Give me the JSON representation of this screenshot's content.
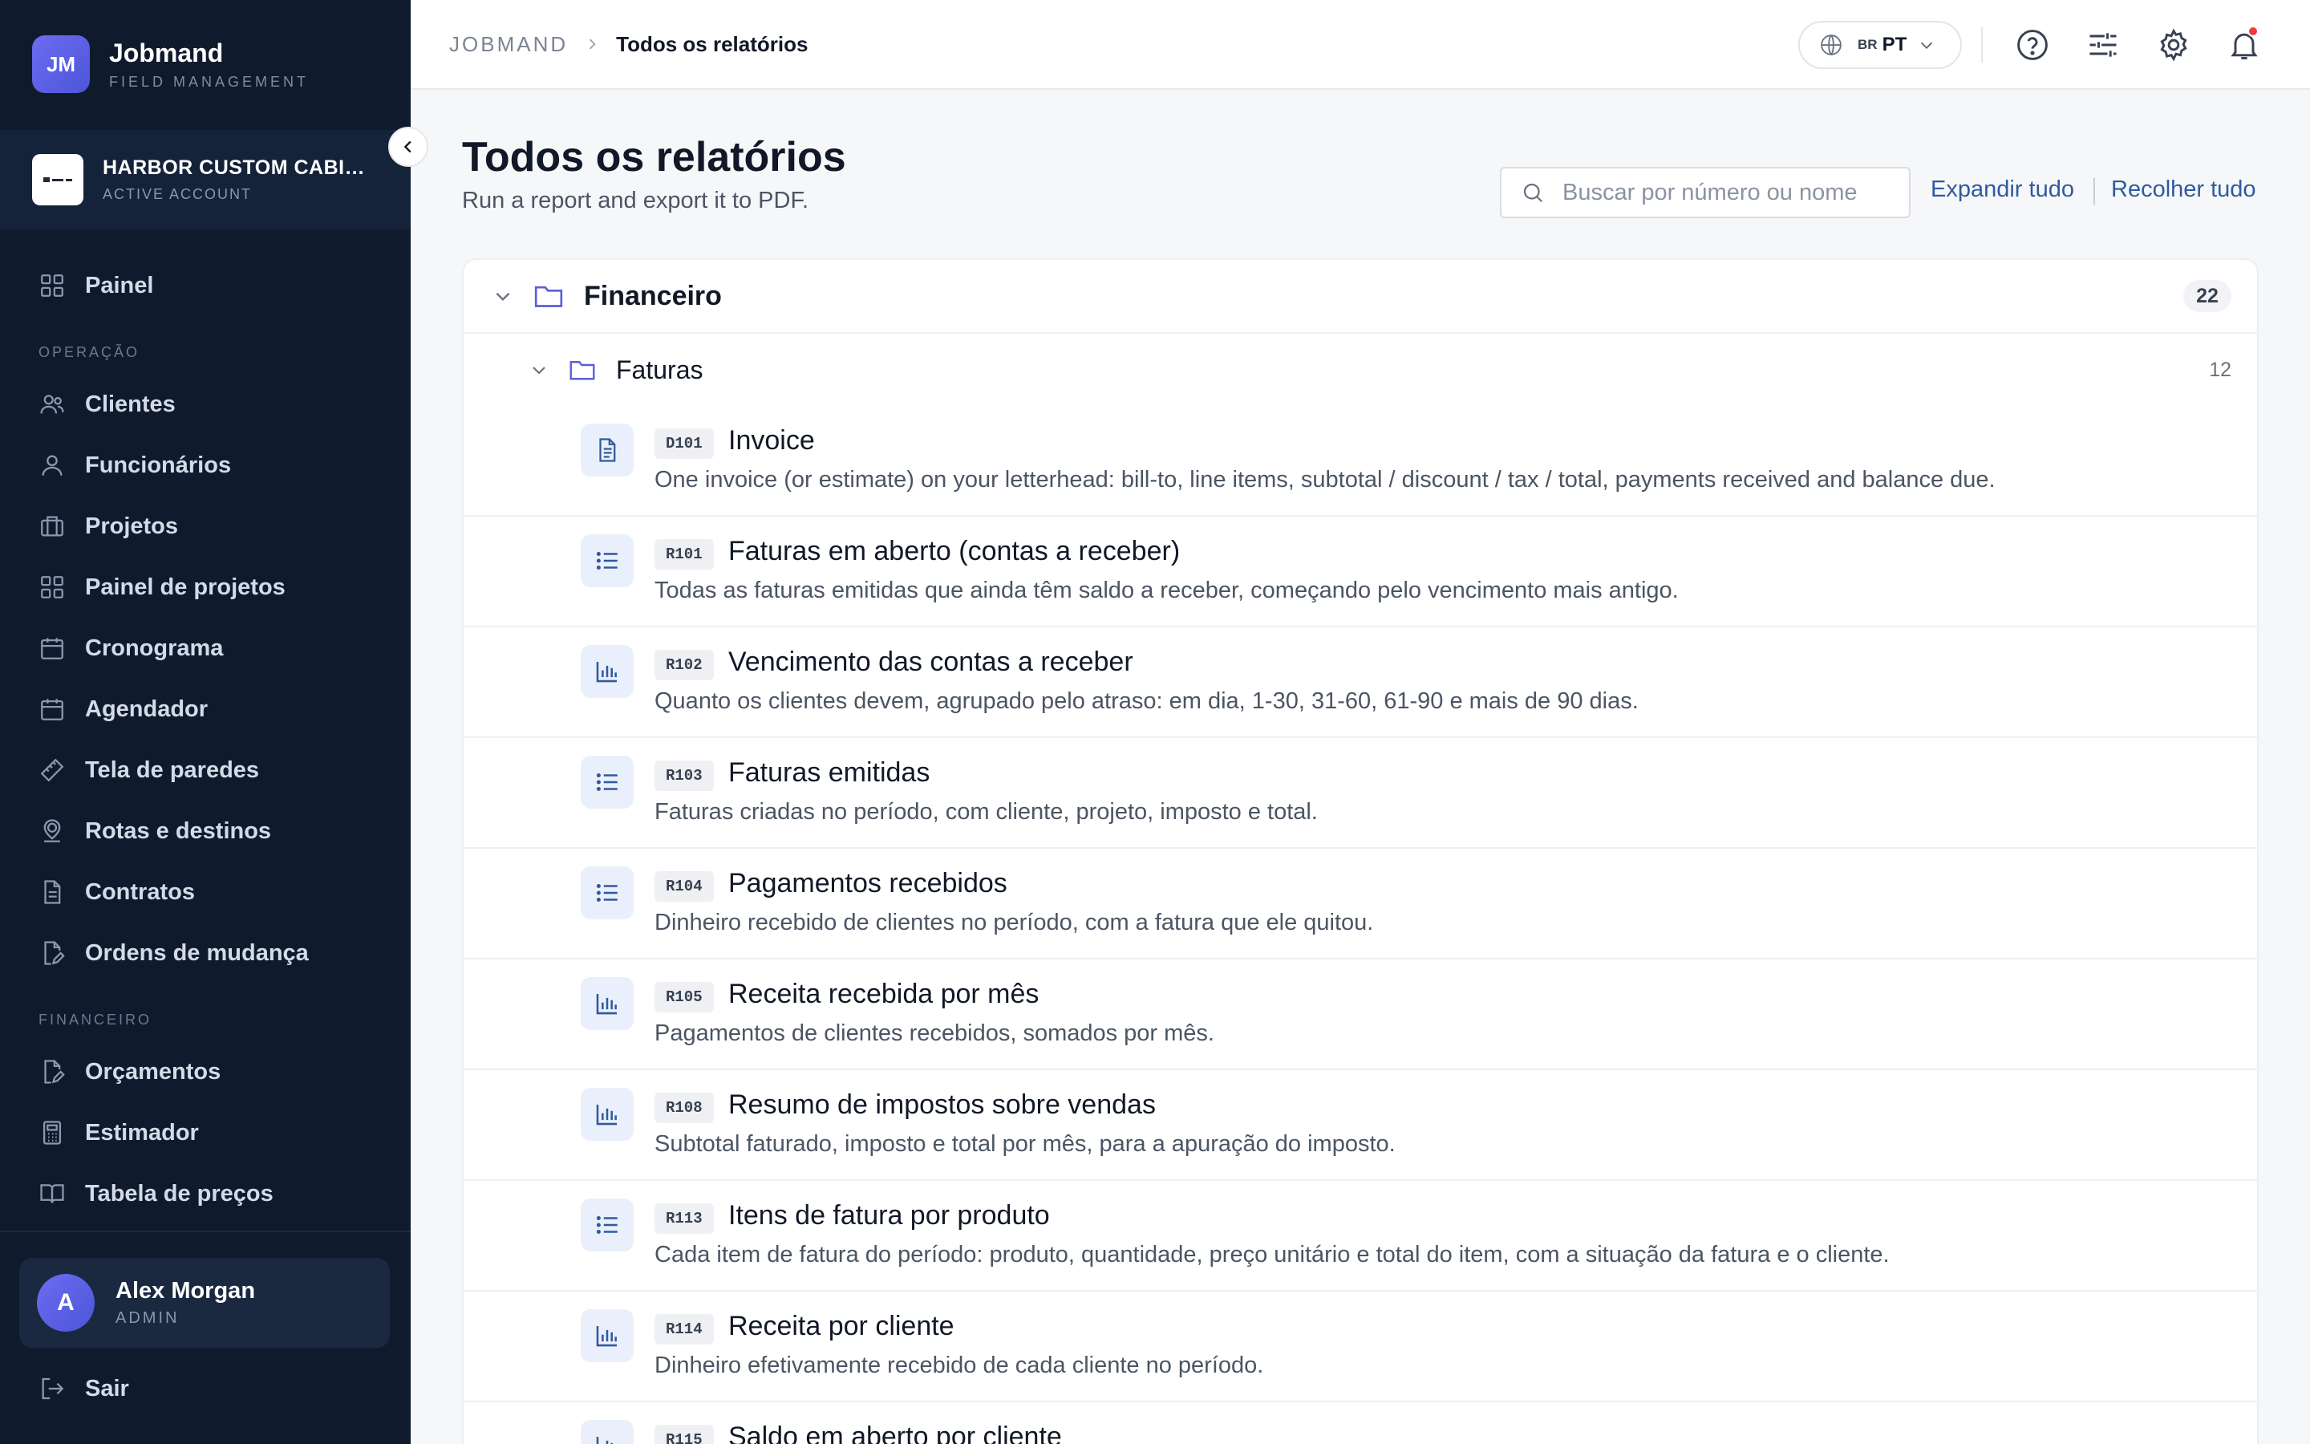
{
  "app": {
    "logo_initials": "JM",
    "name": "Jobmand",
    "subtitle": "FIELD MANAGEMENT"
  },
  "account": {
    "name": "HARBOR CUSTOM CABIN...",
    "status": "ACTIVE ACCOUNT"
  },
  "sidebar": {
    "top_items": [
      {
        "label": "Painel",
        "icon": "dashboard-icon"
      }
    ],
    "sections": [
      {
        "title": "OPERAÇÃO",
        "items": [
          {
            "label": "Clientes",
            "icon": "users-icon"
          },
          {
            "label": "Funcionários",
            "icon": "user-icon"
          },
          {
            "label": "Projetos",
            "icon": "briefcase-icon"
          },
          {
            "label": "Painel de projetos",
            "icon": "grid-icon"
          },
          {
            "label": "Cronograma",
            "icon": "calendar-icon"
          },
          {
            "label": "Agendador",
            "icon": "calendar-icon"
          },
          {
            "label": "Tela de paredes",
            "icon": "ruler-icon"
          },
          {
            "label": "Rotas e destinos",
            "icon": "map-pin-icon"
          },
          {
            "label": "Contratos",
            "icon": "document-icon"
          },
          {
            "label": "Ordens de mudança",
            "icon": "document-edit-icon"
          }
        ]
      },
      {
        "title": "FINANCEIRO",
        "items": [
          {
            "label": "Orçamentos",
            "icon": "document-edit-icon"
          },
          {
            "label": "Estimador",
            "icon": "calculator-icon"
          },
          {
            "label": "Tabela de preços",
            "icon": "book-icon"
          }
        ]
      }
    ]
  },
  "user": {
    "initial": "A",
    "name": "Alex Morgan",
    "role": "ADMIN"
  },
  "logout_label": "Sair",
  "topbar": {
    "breadcrumb_root": "JOBMAND",
    "breadcrumb_current": "Todos os relatórios",
    "language_flag": "BR",
    "language_code": "PT"
  },
  "page": {
    "title": "Todos os relatórios",
    "subtitle": "Run a report and export it to PDF.",
    "search_placeholder": "Buscar por número ou nome",
    "expand_all": "Expandir tudo",
    "collapse_all": "Recolher tudo"
  },
  "group": {
    "label": "Financeiro",
    "count": "22"
  },
  "subgroup": {
    "label": "Faturas",
    "count": "12"
  },
  "reports": [
    {
      "code": "D101",
      "icon": "document-icon",
      "title": "Invoice",
      "description": "One invoice (or estimate) on your letterhead: bill-to, line items, subtotal / discount / tax / total, payments received and balance due."
    },
    {
      "code": "R101",
      "icon": "list-icon",
      "title": "Faturas em aberto (contas a receber)",
      "description": "Todas as faturas emitidas que ainda têm saldo a receber, começando pelo vencimento mais antigo."
    },
    {
      "code": "R102",
      "icon": "bar-chart-icon",
      "title": "Vencimento das contas a receber",
      "description": "Quanto os clientes devem, agrupado pelo atraso: em dia, 1-30, 31-60, 61-90 e mais de 90 dias."
    },
    {
      "code": "R103",
      "icon": "list-icon",
      "title": "Faturas emitidas",
      "description": "Faturas criadas no período, com cliente, projeto, imposto e total."
    },
    {
      "code": "R104",
      "icon": "list-icon",
      "title": "Pagamentos recebidos",
      "description": "Dinheiro recebido de clientes no período, com a fatura que ele quitou."
    },
    {
      "code": "R105",
      "icon": "bar-chart-icon",
      "title": "Receita recebida por mês",
      "description": "Pagamentos de clientes recebidos, somados por mês."
    },
    {
      "code": "R108",
      "icon": "bar-chart-icon",
      "title": "Resumo de impostos sobre vendas",
      "description": "Subtotal faturado, imposto e total por mês, para a apuração do imposto."
    },
    {
      "code": "R113",
      "icon": "list-icon",
      "title": "Itens de fatura por produto",
      "description": "Cada item de fatura do período: produto, quantidade, preço unitário e total do item, com a situação da fatura e o cliente."
    },
    {
      "code": "R114",
      "icon": "bar-chart-icon",
      "title": "Receita por cliente",
      "description": "Dinheiro efetivamente recebido de cada cliente no período."
    },
    {
      "code": "R115",
      "icon": "bar-chart-icon",
      "title": "Saldo em aberto por cliente",
      "description": ""
    }
  ]
}
